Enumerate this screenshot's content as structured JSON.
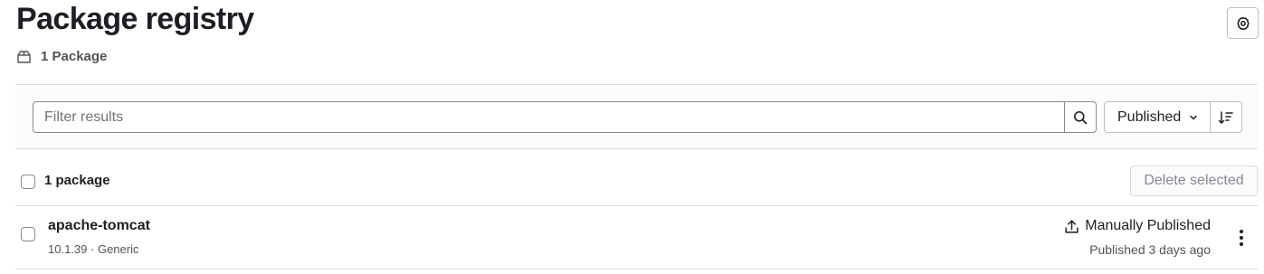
{
  "header": {
    "title": "Package registry",
    "package_count": "1 Package",
    "settings_icon": "gear-icon",
    "package_icon": "package-icon"
  },
  "filter": {
    "placeholder": "Filter results",
    "search_icon": "search-icon",
    "sort_label": "Published",
    "sort_direction_icon": "sort-descending-icon"
  },
  "list": {
    "count_label": "1 package",
    "delete_label": "Delete selected",
    "items": [
      {
        "name": "apache-tomcat",
        "version": "10.1.39",
        "separator": "·",
        "type": "Generic",
        "publish_method": "Manually Published",
        "published_time": "Published 3 days ago"
      }
    ]
  },
  "colors": {
    "text": "#1f1e24",
    "muted": "#535158",
    "border": "#dcdcde",
    "filter_bg": "#fbfafd"
  }
}
